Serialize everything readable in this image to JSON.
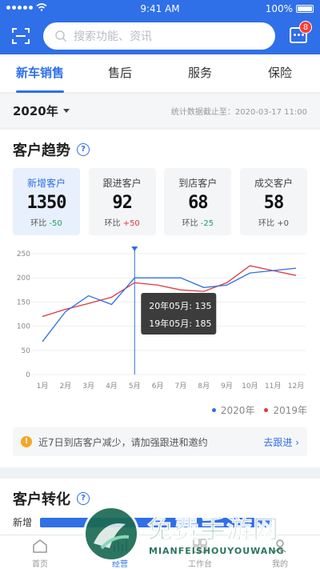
{
  "status_bar": {
    "time": "9:41 AM",
    "battery": "100%"
  },
  "header": {
    "search_placeholder": "搜索功能、资讯",
    "message_badge": "8",
    "colors": {
      "brand": "#2f6fe8",
      "badge": "#ff3b30"
    }
  },
  "tabs": [
    {
      "label": "新车销售",
      "active": true
    },
    {
      "label": "售后",
      "active": false
    },
    {
      "label": "服务",
      "active": false
    },
    {
      "label": "保险",
      "active": false
    }
  ],
  "filter": {
    "year": "2020年",
    "as_of": "统计数据截止至：2020-03-17 11:00"
  },
  "trend": {
    "title": "客户趋势",
    "stats": [
      {
        "label": "新增客户",
        "value": "1350",
        "ratio_label": "环比",
        "ratio": "-50",
        "dir": "down",
        "active": true
      },
      {
        "label": "跟进客户",
        "value": "92",
        "ratio_label": "环比",
        "ratio": "+50",
        "dir": "up",
        "active": false
      },
      {
        "label": "到店客户",
        "value": "68",
        "ratio_label": "环比",
        "ratio": "-25",
        "dir": "down",
        "active": false
      },
      {
        "label": "成交客户",
        "value": "58",
        "ratio_label": "环比",
        "ratio": "+0",
        "dir": "zero",
        "active": false
      }
    ],
    "legend": [
      "2020年",
      "2019年"
    ],
    "tooltip": {
      "line1": "20年05月: 135",
      "line2": "19年05月: 185"
    }
  },
  "chart_data": {
    "type": "line",
    "categories": [
      "1月",
      "2月",
      "3月",
      "4月",
      "5月",
      "6月",
      "7月",
      "8月",
      "9月",
      "10月",
      "11月",
      "12月"
    ],
    "series": [
      {
        "name": "2020年",
        "color": "#2f6fe8",
        "values": [
          68,
          130,
          163,
          145,
          200,
          200,
          200,
          180,
          185,
          210,
          215,
          220
        ]
      },
      {
        "name": "2019年",
        "color": "#e0383e",
        "values": [
          120,
          135,
          147,
          160,
          190,
          185,
          175,
          172,
          190,
          225,
          215,
          205
        ]
      }
    ],
    "yticks": [
      0,
      50,
      100,
      150,
      200,
      250
    ],
    "ylim": [
      0,
      250
    ],
    "highlight_category": "5月",
    "grid": true,
    "legend_position": "bottom-right"
  },
  "notice": {
    "icon": "!",
    "text": "近7日到店客户减少，请加强跟进和邀约",
    "action": "去跟进"
  },
  "conversion": {
    "title": "客户转化",
    "row_label": "新增"
  },
  "bottom_nav": [
    {
      "label": "首页",
      "icon": "home-icon",
      "active": false
    },
    {
      "label": "经营",
      "icon": "chart-icon",
      "active": true
    },
    {
      "label": "工作台",
      "icon": "grid-icon",
      "active": false
    },
    {
      "label": "我的",
      "icon": "user-icon",
      "active": false
    }
  ],
  "watermark": {
    "title": "免费手游网",
    "subtitle": "MIANFEISHOUYOUWANG"
  }
}
